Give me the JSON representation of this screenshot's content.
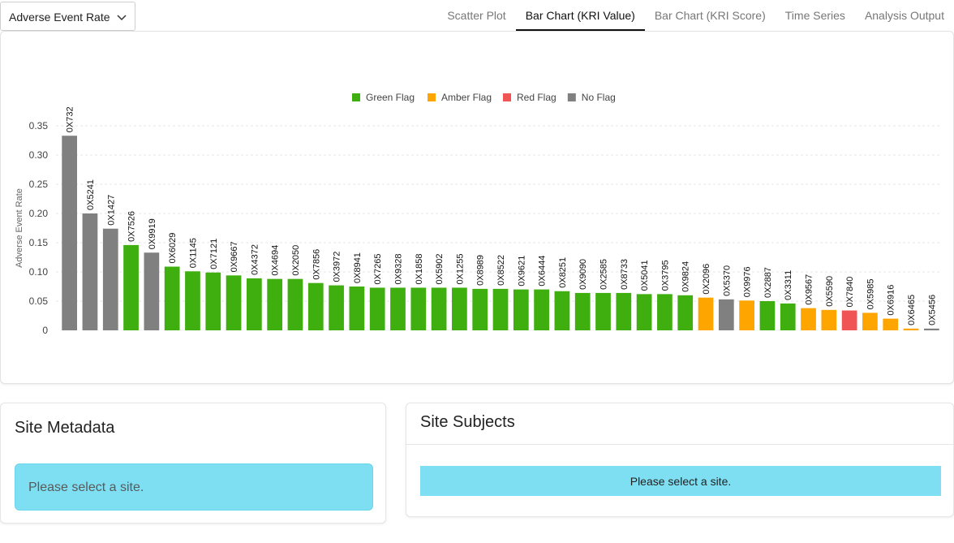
{
  "header": {
    "metric_select": "Adverse Event Rate",
    "tabs": [
      "Scatter Plot",
      "Bar Chart (KRI Value)",
      "Bar Chart (KRI Score)",
      "Time Series",
      "Analysis Output"
    ],
    "active_tab": 1
  },
  "colors": {
    "green": "#3fae0f",
    "amber": "#ffa500",
    "red": "#f05454",
    "none": "#808080"
  },
  "chart_data": {
    "type": "bar",
    "ylabel": "Adverse Event Rate",
    "ylim": [
      0,
      0.35
    ],
    "yticks": [
      "0",
      "0.05",
      "0.10",
      "0.15",
      "0.20",
      "0.25",
      "0.30",
      "0.35"
    ],
    "grid": true,
    "legend": {
      "placement": "top",
      "entries": [
        {
          "label": "Green Flag",
          "flag": "green"
        },
        {
          "label": "Amber Flag",
          "flag": "amber"
        },
        {
          "label": "Red Flag",
          "flag": "red"
        },
        {
          "label": "No Flag",
          "flag": "none"
        }
      ]
    },
    "bars": [
      {
        "site": "0X732",
        "value": 0.333,
        "flag": "none"
      },
      {
        "site": "0X5241",
        "value": 0.2,
        "flag": "none"
      },
      {
        "site": "0X1427",
        "value": 0.174,
        "flag": "none"
      },
      {
        "site": "0X7526",
        "value": 0.146,
        "flag": "green"
      },
      {
        "site": "0X9919",
        "value": 0.133,
        "flag": "none"
      },
      {
        "site": "0X6029",
        "value": 0.109,
        "flag": "green"
      },
      {
        "site": "0X1145",
        "value": 0.101,
        "flag": "green"
      },
      {
        "site": "0X7121",
        "value": 0.099,
        "flag": "green"
      },
      {
        "site": "0X9667",
        "value": 0.094,
        "flag": "green"
      },
      {
        "site": "0X4372",
        "value": 0.089,
        "flag": "green"
      },
      {
        "site": "0X4694",
        "value": 0.088,
        "flag": "green"
      },
      {
        "site": "0X2050",
        "value": 0.088,
        "flag": "green"
      },
      {
        "site": "0X7856",
        "value": 0.081,
        "flag": "green"
      },
      {
        "site": "0X3972",
        "value": 0.077,
        "flag": "green"
      },
      {
        "site": "0X8941",
        "value": 0.075,
        "flag": "green"
      },
      {
        "site": "0X7265",
        "value": 0.073,
        "flag": "green"
      },
      {
        "site": "0X9328",
        "value": 0.073,
        "flag": "green"
      },
      {
        "site": "0X1858",
        "value": 0.073,
        "flag": "green"
      },
      {
        "site": "0X5902",
        "value": 0.073,
        "flag": "green"
      },
      {
        "site": "0X1255",
        "value": 0.073,
        "flag": "green"
      },
      {
        "site": "0X8989",
        "value": 0.071,
        "flag": "green"
      },
      {
        "site": "0X8522",
        "value": 0.071,
        "flag": "green"
      },
      {
        "site": "0X9621",
        "value": 0.07,
        "flag": "green"
      },
      {
        "site": "0X6444",
        "value": 0.07,
        "flag": "green"
      },
      {
        "site": "0X8251",
        "value": 0.067,
        "flag": "green"
      },
      {
        "site": "0X9090",
        "value": 0.064,
        "flag": "green"
      },
      {
        "site": "0X2585",
        "value": 0.064,
        "flag": "green"
      },
      {
        "site": "0X8733",
        "value": 0.064,
        "flag": "green"
      },
      {
        "site": "0X5041",
        "value": 0.062,
        "flag": "green"
      },
      {
        "site": "0X3795",
        "value": 0.062,
        "flag": "green"
      },
      {
        "site": "0X9824",
        "value": 0.06,
        "flag": "green"
      },
      {
        "site": "0X2096",
        "value": 0.056,
        "flag": "amber"
      },
      {
        "site": "0X5370",
        "value": 0.053,
        "flag": "none"
      },
      {
        "site": "0X9976",
        "value": 0.051,
        "flag": "amber"
      },
      {
        "site": "0X2887",
        "value": 0.05,
        "flag": "green"
      },
      {
        "site": "0X3311",
        "value": 0.046,
        "flag": "green"
      },
      {
        "site": "0X9567",
        "value": 0.038,
        "flag": "amber"
      },
      {
        "site": "0X5590",
        "value": 0.035,
        "flag": "amber"
      },
      {
        "site": "0X7840",
        "value": 0.034,
        "flag": "red"
      },
      {
        "site": "0X5985",
        "value": 0.03,
        "flag": "amber"
      },
      {
        "site": "0X6916",
        "value": 0.02,
        "flag": "amber"
      },
      {
        "site": "0X6465",
        "value": 0.003,
        "flag": "amber"
      },
      {
        "site": "0X5456",
        "value": 0.003,
        "flag": "none"
      }
    ]
  },
  "metadata": {
    "title": "Site Metadata",
    "message": "Please select a site."
  },
  "subjects": {
    "title": "Site Subjects",
    "message": "Please select a site."
  }
}
